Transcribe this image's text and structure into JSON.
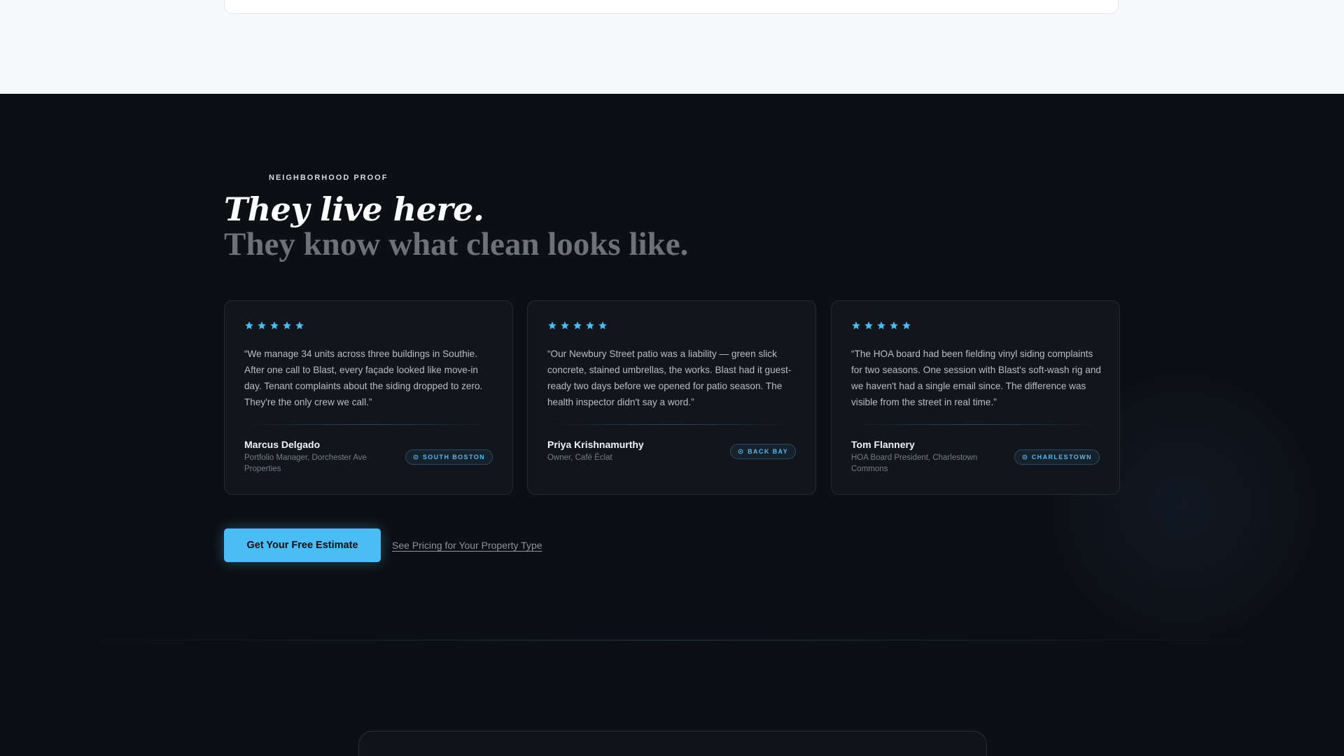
{
  "section": {
    "eyebrow": "NEIGHBORHOOD PROOF",
    "headline_primary": "They live here.",
    "headline_secondary": "They know what clean looks like."
  },
  "colors": {
    "accent": "#4cbcf5",
    "star": "#4cbcf5",
    "background_dark": "#0c0f14",
    "background_light": "#f8f9fb"
  },
  "testimonials": [
    {
      "rating": 5,
      "quote": "“We manage 34 units across three buildings in Southie. After one call to Blast, every façade looked like move-in day. Tenant complaints about the siding dropped to zero. They're the only crew we call.”",
      "name": "Marcus Delgado",
      "role": "Portfolio Manager, Dorchester Ave Properties",
      "neighborhood": "SOUTH BOSTON",
      "icon": "map-pin-icon"
    },
    {
      "rating": 5,
      "quote": "“Our Newbury Street patio was a liability — green slick concrete, stained umbrellas, the works. Blast had it guest-ready two days before we opened for patio season. The health inspector didn't say a word.”",
      "name": "Priya Krishnamurthy",
      "role": "Owner, Café Éclat",
      "neighborhood": "BACK BAY",
      "icon": "map-pin-icon"
    },
    {
      "rating": 5,
      "quote": "“The HOA board had been fielding vinyl siding complaints for two seasons. One session with Blast's soft-wash rig and we haven't had a single email since. The difference was visible from the street in real time.”",
      "name": "Tom Flannery",
      "role": "HOA Board President, Charlestown Commons",
      "neighborhood": "CHARLESTOWN",
      "icon": "map-pin-icon"
    }
  ],
  "cta": {
    "primary_label": "Get Your Free Estimate",
    "secondary_label": "See Pricing for Your Property Type"
  }
}
